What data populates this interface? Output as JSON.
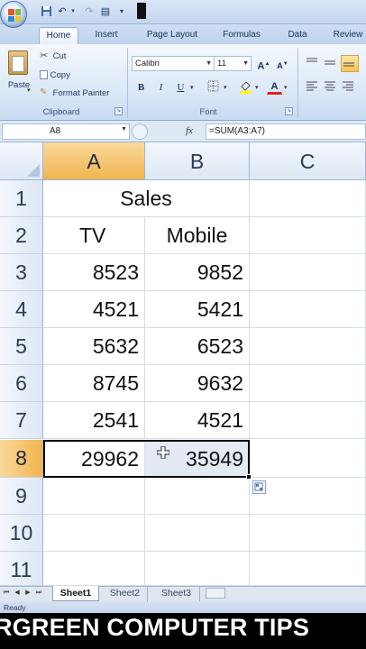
{
  "ribbon": {
    "tabs": [
      "Home",
      "Insert",
      "Page Layout",
      "Formulas",
      "Data",
      "Review"
    ],
    "clipboard": {
      "paste_label": "Paste",
      "cut_label": "Cut",
      "copy_label": "Copy",
      "format_painter_label": "Format Painter",
      "group_label": "Clipboard"
    },
    "font": {
      "font_name": "Calibri",
      "font_size": "11",
      "bold": "B",
      "italic": "I",
      "underline": "U",
      "font_color_letter": "A",
      "grow_font": "A",
      "shrink_font": "A",
      "group_label": "Font"
    }
  },
  "formula_bar": {
    "name_box": "A8",
    "fx": "fx",
    "formula": "=SUM(A3:A7)"
  },
  "grid": {
    "columns": [
      "A",
      "B",
      "C"
    ],
    "selected_column": "A",
    "rows": [
      {
        "num": "1",
        "title": "Sales"
      },
      {
        "num": "2",
        "a": "TV",
        "b": "Mobile"
      },
      {
        "num": "3",
        "a": "8523",
        "b": "9852"
      },
      {
        "num": "4",
        "a": "4521",
        "b": "5421"
      },
      {
        "num": "5",
        "a": "5632",
        "b": "6523"
      },
      {
        "num": "6",
        "a": "8745",
        "b": "9632"
      },
      {
        "num": "7",
        "a": "2541",
        "b": "4521"
      },
      {
        "num": "8",
        "a": "29962",
        "b": "35949"
      },
      {
        "num": "9"
      },
      {
        "num": "10"
      },
      {
        "num": "11"
      }
    ],
    "selected_row": "8"
  },
  "sheet_tabs": {
    "tabs": [
      "Sheet1",
      "Sheet2",
      "Sheet3"
    ],
    "active": "Sheet1"
  },
  "status": {
    "text": "Ready"
  },
  "banner": {
    "text": "RGREEN COMPUTER TIPS"
  },
  "colors": {
    "ribbon_bg": "#dde9f7",
    "selected_header": "#f1b44f",
    "grid_line": "#d6dde7",
    "banner_bg": "#000000"
  }
}
